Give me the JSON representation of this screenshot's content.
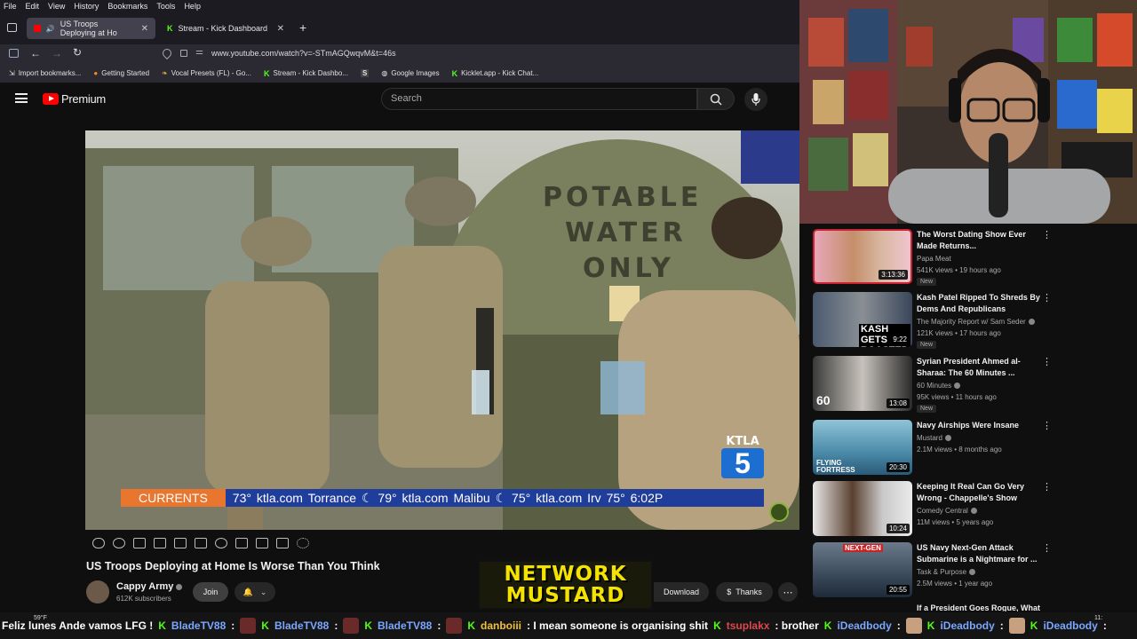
{
  "menubar": {
    "items": [
      "File",
      "Edit",
      "View",
      "History",
      "Bookmarks",
      "Tools",
      "Help"
    ]
  },
  "tabs": [
    {
      "label": "US Troops Deploying at Ho"
    },
    {
      "label": "Stream - Kick Dashboard"
    }
  ],
  "url": "www.youtube.com/watch?v=-STmAGQwqvM&t=46s",
  "bookmarks": [
    "Import bookmarks...",
    "Getting Started",
    "Vocal Presets (FL) - Go...",
    "Stream - Kick Dashbo...",
    "Google Images",
    "Kicklet.app - Kick Chat..."
  ],
  "youtube": {
    "logo_text": "Premium",
    "search_placeholder": "Search"
  },
  "video": {
    "tanker_text": [
      "POTABLE",
      "WATER",
      "ONLY"
    ],
    "ticker_label": "CURRENTS",
    "ticker_text": "73°  ktla.com  Torrance  ☾ 79°  ktla.com  Malibu  ☾ 75°  ktla.com  Irv 75°   6:02P",
    "station": "KTLA",
    "channel_number": "5",
    "title": "US Troops Deploying at Home Is Worse Than You Think",
    "channel": "Cappy Army",
    "subscribers": "612K subscribers",
    "join_label": "Join",
    "download_label": "Download",
    "thanks_label": "Thanks"
  },
  "overlay": {
    "line1": "NETWORK",
    "line2": "MUSTARD"
  },
  "recommendations": [
    {
      "title": "The Worst Dating Show Ever Made Returns...",
      "channel": "Papa Meat",
      "meta": "541K views • 19 hours ago",
      "badge": "New",
      "duration": "3:13:36"
    },
    {
      "title": "Kash Patel Ripped To Shreds By Dems And Republicans",
      "channel": "The Majority Report w/ Sam Seder",
      "meta": "121K views • 17 hours ago",
      "badge": "New",
      "duration": "9:22"
    },
    {
      "title": "Syrian President Ahmed al-Sharaa: The 60 Minutes ...",
      "channel": "60 Minutes",
      "meta": "95K views • 11 hours ago",
      "badge": "New",
      "duration": "13:08"
    },
    {
      "title": "Navy Airships Were Insane",
      "channel": "Mustard",
      "meta": "2.1M views • 8 months ago",
      "badge": "",
      "duration": "20:30"
    },
    {
      "title": "Keeping It Real Can Go Very Wrong - Chappelle's Show",
      "channel": "Comedy Central",
      "meta": "11M views • 5 years ago",
      "badge": "",
      "duration": "10:24"
    },
    {
      "title": "US Navy Next-Gen Attack Submarine is a Nightmare for ...",
      "channel": "Task & Purpose",
      "meta": "2.5M views • 1 year ago",
      "badge": "",
      "duration": "20:55"
    },
    {
      "title": "If a President Goes Rogue, What",
      "channel": "",
      "meta": "",
      "badge": "",
      "duration": ""
    }
  ],
  "thumb_text": {
    "r1": "KASH GETS ROASTED",
    "r2": "60",
    "r3": "FLYING FORTRESS",
    "r4": "NEXT-GEN"
  },
  "chat": [
    {
      "user": "",
      "msg": "Feliz lunes Ande vamos LFG !"
    },
    {
      "user": "BladeTV88",
      "msg": ":"
    },
    {
      "user": "BladeTV88",
      "msg": ":"
    },
    {
      "user": "BladeTV88",
      "msg": ":"
    },
    {
      "user": "danboiii",
      "msg": ": I mean someone is organising shit"
    },
    {
      "user": "tsuplakx",
      "msg": ": brother"
    },
    {
      "user": "iDeadbody",
      "msg": ":"
    },
    {
      "user": "iDeadbody",
      "msg": ":"
    },
    {
      "user": "iDeadbody",
      "msg": ":"
    }
  ],
  "system": {
    "temp": "59°F",
    "clock": "11:"
  },
  "colors": {
    "kick_green": "#53fc18",
    "yt_red": "#ff0000",
    "ticker_orange": "#e9762f",
    "ticker_blue": "#1f3d9a",
    "mustard_yellow": "#f4e300"
  }
}
